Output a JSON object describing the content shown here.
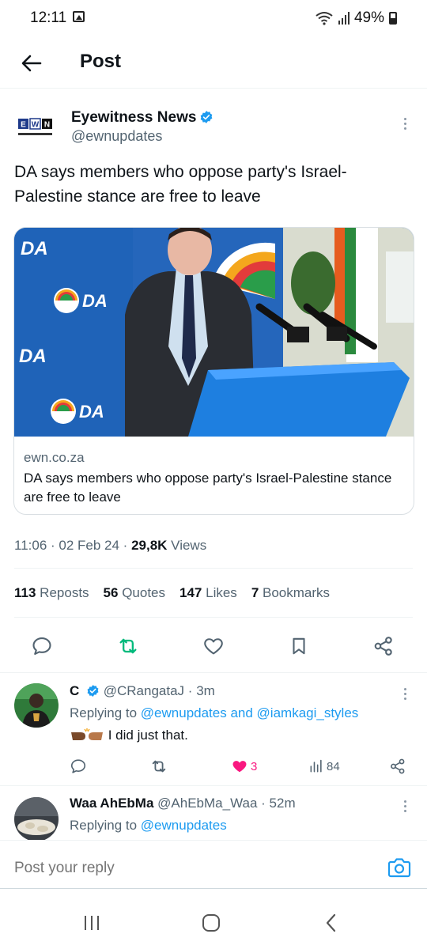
{
  "status_bar": {
    "time": "12:11",
    "battery": "49%"
  },
  "header": {
    "title": "Post"
  },
  "tweet": {
    "author_name": "Eyewitness News",
    "author_handle": "@ewnupdates",
    "logo_text": "EWN",
    "logo_subtext": "EYEWITNESS NEWS",
    "text": "DA says members who oppose party's Israel-Palestine stance are free to leave",
    "card": {
      "domain": "ewn.co.za",
      "title": "DA says members who oppose party's Israel-Palestine stance are free to leave",
      "backdrop_text": "DA"
    },
    "time": "11:06",
    "date": "02 Feb 24",
    "views_count": "29,8K",
    "views_label": "Views",
    "stats": {
      "reposts_count": "113",
      "reposts_label": "Reposts",
      "quotes_count": "56",
      "quotes_label": "Quotes",
      "likes_count": "147",
      "likes_label": "Likes",
      "bookmarks_count": "7",
      "bookmarks_label": "Bookmarks"
    }
  },
  "replies": [
    {
      "name": "C",
      "handle": "@CRangataJ",
      "time": "3m",
      "replying_prefix": "Replying to",
      "replying_to": "@ewnupdates and @iamkagi_styles",
      "text": "I did just that.",
      "likes": "3",
      "views": "84"
    },
    {
      "name": "Waa AhEbMa",
      "handle": "@AhEbMa_Waa",
      "time": "52m",
      "replying_prefix": "Replying to",
      "replying_to": "@ewnupdates"
    }
  ],
  "compose": {
    "placeholder": "Post your reply"
  },
  "colors": {
    "accent": "#1d9bf0",
    "repost_active": "#00ba7c",
    "like_active": "#f91880",
    "muted": "#536471"
  }
}
